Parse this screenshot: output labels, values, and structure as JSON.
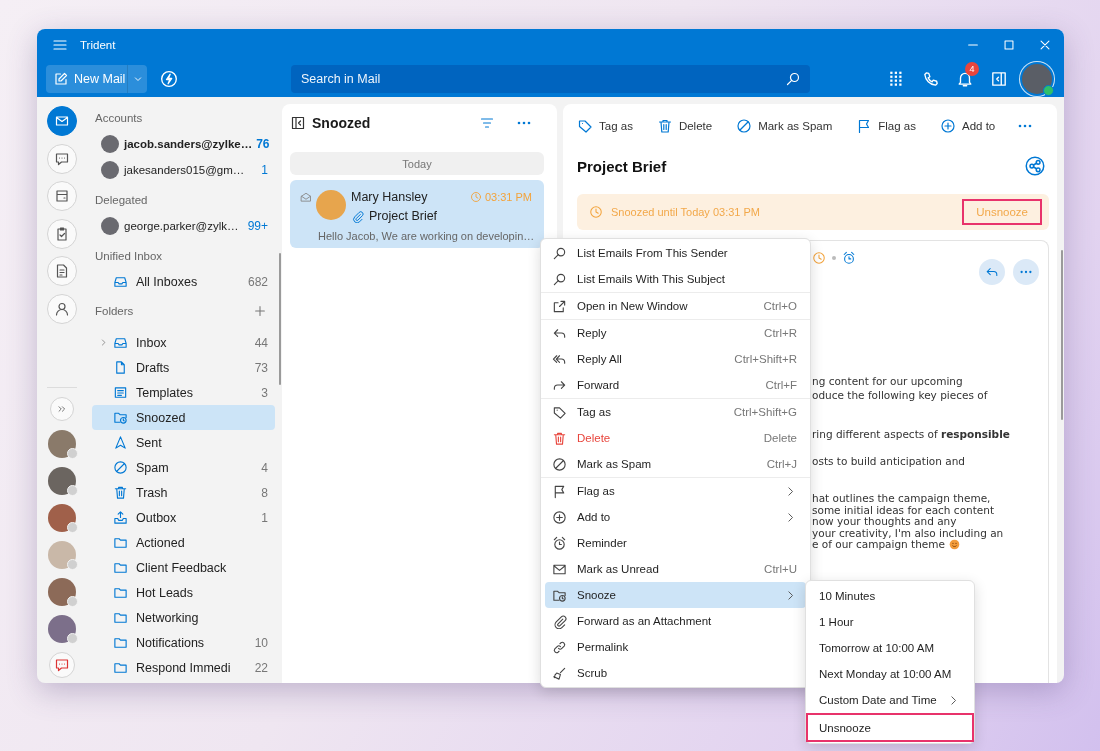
{
  "window": {
    "title": "Trident"
  },
  "toolbar": {
    "new_mail": "New Mail",
    "search": {
      "placeholder": "Search in Mail"
    },
    "notification_count": "4",
    "user_online": true
  },
  "rail": {
    "items": [
      {
        "selected": true
      },
      {
        "selected": false
      },
      {
        "selected": false
      },
      {
        "selected": false
      },
      {
        "selected": false
      },
      {
        "selected": false
      }
    ],
    "contacts": [
      {
        "online": false
      },
      {
        "online": false
      },
      {
        "online": false
      },
      {
        "online": false
      },
      {
        "online": false
      },
      {
        "online": false
      }
    ]
  },
  "folder_pane": {
    "accounts_header": "Accounts",
    "accounts": [
      {
        "name": "jacob.sanders@zylke…",
        "count": "76",
        "selected": true
      },
      {
        "name": "jakesanders015@gm…",
        "count": "1",
        "selected": false
      }
    ],
    "delegated_header": "Delegated",
    "delegated": [
      {
        "name": "george.parker@zylk…",
        "count": "99+",
        "selected": false
      }
    ],
    "unified_header": "Unified Inbox",
    "unified": [
      {
        "name": "All Inboxes",
        "count": "682",
        "selected": false
      }
    ],
    "folders_header": "Folders",
    "folders": [
      {
        "name": "Inbox",
        "count": "44",
        "expandable": true,
        "selected": false
      },
      {
        "name": "Drafts",
        "count": "73",
        "expandable": false,
        "selected": false
      },
      {
        "name": "Templates",
        "count": "3",
        "expandable": false,
        "selected": false
      },
      {
        "name": "Snoozed",
        "expandable": false,
        "selected": true
      },
      {
        "name": "Sent",
        "expandable": false,
        "selected": false
      },
      {
        "name": "Spam",
        "count": "4",
        "expandable": false,
        "selected": false
      },
      {
        "name": "Trash",
        "count": "8",
        "expandable": false,
        "selected": false
      },
      {
        "name": "Outbox",
        "count": "1",
        "expandable": false,
        "selected": false
      },
      {
        "name": "Actioned",
        "expandable": false,
        "selected": false
      },
      {
        "name": "Client Feedback",
        "expandable": false,
        "selected": false
      },
      {
        "name": "Hot Leads",
        "expandable": false,
        "selected": false
      },
      {
        "name": "Networking",
        "expandable": false,
        "selected": false
      },
      {
        "name": "Notifications",
        "count": "10",
        "expandable": false,
        "selected": false
      },
      {
        "name": "Respond Immedi",
        "count": "22",
        "expandable": false,
        "selected": false
      }
    ]
  },
  "message_list": {
    "title": "Snoozed",
    "groups": [
      {
        "label": "Today",
        "messages": [
          {
            "sender": "Mary Hansley",
            "time": "03:31 PM",
            "subject": "Project Brief",
            "preview": "Hello Jacob, We are working on developin…",
            "selected": true
          }
        ]
      }
    ]
  },
  "reading_pane": {
    "actions": [
      "Tag as",
      "Delete",
      "Mark as Spam",
      "Flag as",
      "Add to"
    ],
    "subject": "Project Brief",
    "snooze_banner": {
      "text": "Snoozed until Today 03:31 PM",
      "action": "Unsnooze",
      "outlined": true
    },
    "body_fragments": [
      [
        "ng content for our upcoming",
        "oduce the following key pieces of"
      ],
      [
        "ring different aspects of **responsible**"
      ],
      [
        "osts to build anticipation and"
      ],
      [
        "hat outlines the campaign theme,",
        "some initial ideas for each content",
        "now your thoughts and any",
        "your creativity, I'm also including an",
        "e of our campaign theme"
      ]
    ]
  },
  "context_menu": {
    "groups": [
      [
        {
          "label": "List Emails From This Sender",
          "kind": "item",
          "selected": false
        },
        {
          "label": "List Emails With This Subject",
          "kind": "item",
          "selected": false
        }
      ],
      [
        {
          "label": "Open in New Window",
          "shortcut": "Ctrl+O",
          "kind": "item",
          "selected": false
        }
      ],
      [
        {
          "label": "Reply",
          "shortcut": "Ctrl+R",
          "kind": "item",
          "selected": false
        },
        {
          "label": "Reply All",
          "shortcut": "Ctrl+Shift+R",
          "kind": "item",
          "selected": false
        },
        {
          "label": "Forward",
          "shortcut": "Ctrl+F",
          "kind": "item",
          "selected": false
        }
      ],
      [
        {
          "label": "Tag as",
          "shortcut": "Ctrl+Shift+G",
          "kind": "item",
          "selected": false
        },
        {
          "label": "Delete",
          "shortcut": "Delete",
          "kind": "danger",
          "selected": false
        },
        {
          "label": "Mark as Spam",
          "shortcut": "Ctrl+J",
          "kind": "item",
          "selected": false
        }
      ],
      [
        {
          "label": "Flag as",
          "kind": "submenu",
          "selected": false
        },
        {
          "label": "Add to",
          "kind": "submenu",
          "selected": false
        },
        {
          "label": "Reminder",
          "kind": "item",
          "selected": false
        },
        {
          "label": "Mark as Unread",
          "shortcut": "Ctrl+U",
          "kind": "item",
          "selected": false
        },
        {
          "label": "Snooze",
          "kind": "submenu",
          "selected": true
        },
        {
          "label": "Forward as an Attachment",
          "kind": "item",
          "selected": false
        },
        {
          "label": "Permalink",
          "kind": "item",
          "selected": false
        },
        {
          "label": "Scrub",
          "kind": "item",
          "selected": false
        }
      ]
    ]
  },
  "snooze_submenu": {
    "items": [
      {
        "label": "10 Minutes",
        "kind": "item",
        "outlined": false
      },
      {
        "label": "1 Hour",
        "kind": "item",
        "outlined": false
      },
      {
        "label": "Tomorrow at 10:00 AM",
        "kind": "item",
        "outlined": false
      },
      {
        "label": "Next Monday at 10:00 AM",
        "kind": "item",
        "outlined": false
      },
      {
        "label": "Custom Date and Time",
        "kind": "submenu",
        "outlined": false
      },
      {
        "label": "Unsnooze",
        "kind": "item",
        "outlined": true
      }
    ]
  }
}
